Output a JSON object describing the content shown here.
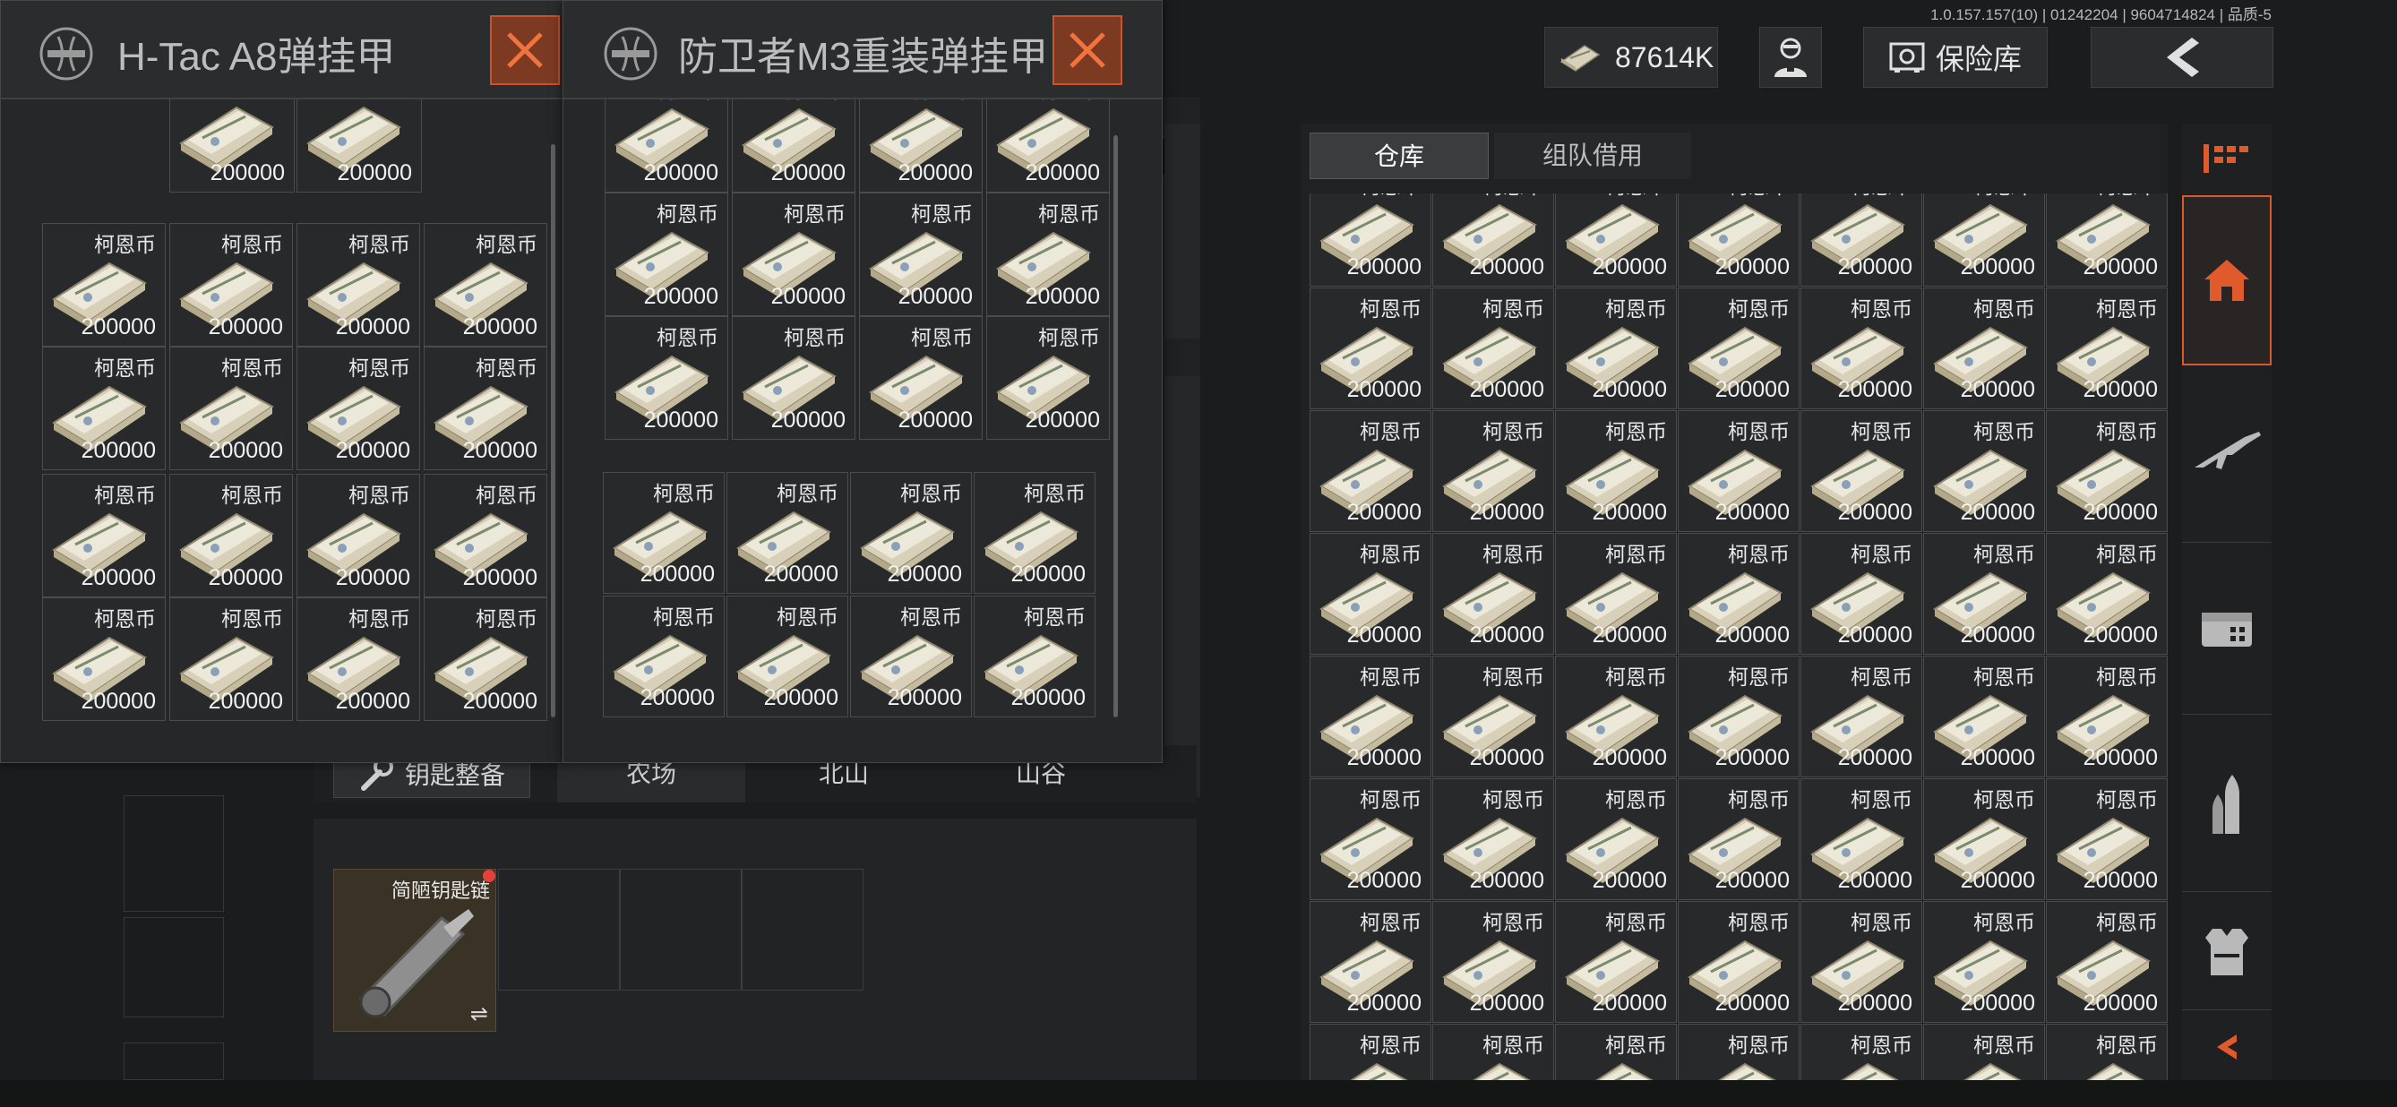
{
  "version_info": "1.0.157.157(10) | 01242204 | 9604714824 | 品质-5",
  "top_bar": {
    "currency_amount": "87614K",
    "vault_label": "保险库"
  },
  "popups": [
    {
      "title": "H-Tac A8弹挂甲"
    },
    {
      "title": "防卫者M3重装弹挂甲"
    }
  ],
  "background": {
    "tabs": [
      "钥匙整备",
      "农场",
      "北山",
      "山谷"
    ],
    "key_item": {
      "name": "简陋钥匙链",
      "swap_symbol": "⇌"
    }
  },
  "warehouse": {
    "tabs": [
      "仓库",
      "组队借用"
    ]
  },
  "item": {
    "name": "柯恩币",
    "value": "200000"
  },
  "sidebar_icons": [
    "home-icon",
    "rifle-icon",
    "box-icon",
    "ammo-icon",
    "armor-vest-icon",
    "collapse-arrow-icon"
  ],
  "colors": {
    "accent": "#d9592e",
    "close_bg": "#7d3a22"
  }
}
